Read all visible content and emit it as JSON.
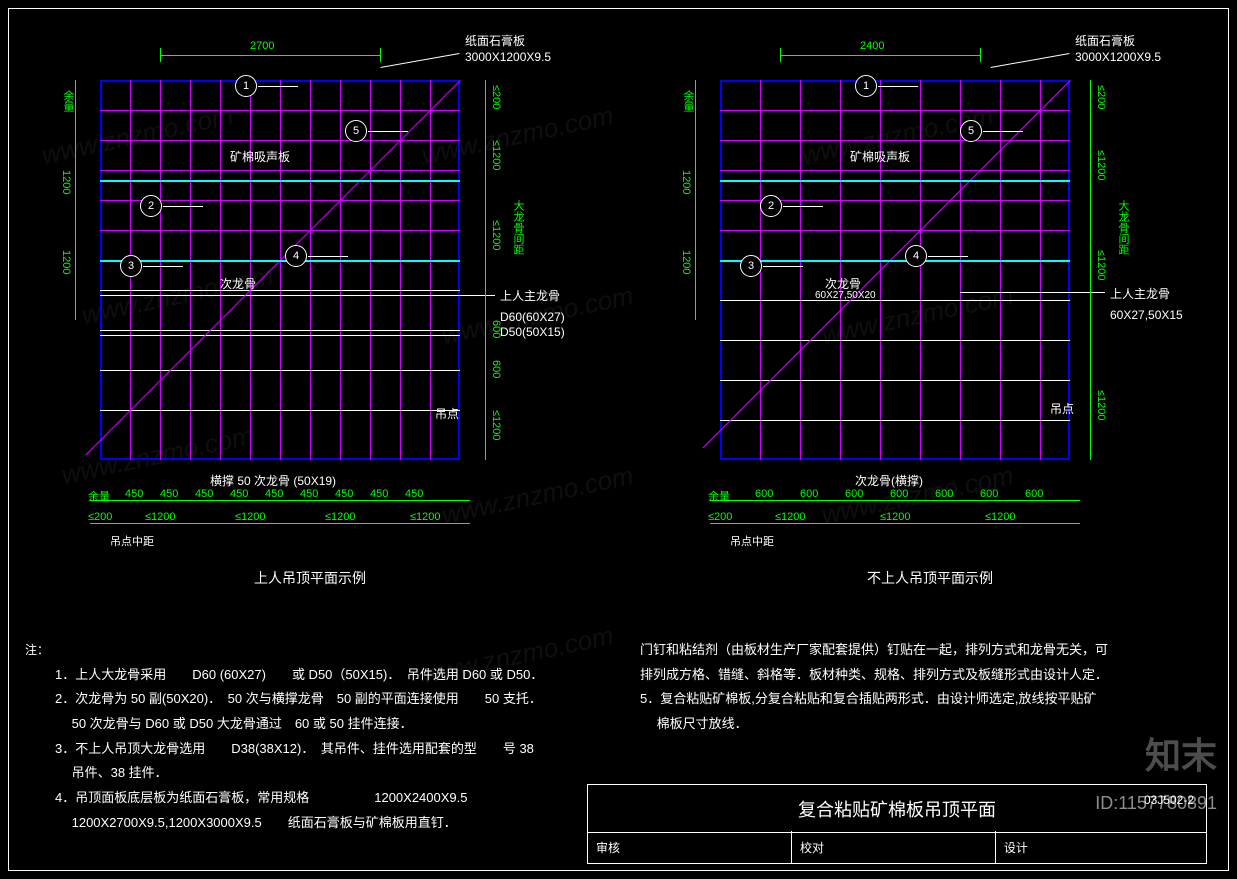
{
  "plans": {
    "left": {
      "top_dim": "2700",
      "top_label": "纸面石膏板",
      "top_spec": "3000X1200X9.5",
      "panel_label": "矿棉吸声板",
      "sub_keel": "次龙骨",
      "main_keel": "上人主龙骨",
      "keel_spec1": "D60(60X27)",
      "keel_spec2": "D50(50X15)",
      "hang_point": "吊点",
      "bottom_keel": "横撑 50 次龙骨  (50X19)",
      "bottom_dims": [
        "余量",
        "450",
        "450",
        "450",
        "450",
        "450",
        "450",
        "450",
        "450",
        "450"
      ],
      "bottom_groups": [
        "≤200",
        "≤1200",
        "≤1200",
        "≤1200",
        "≤1200"
      ],
      "bottom_label": "吊点中距",
      "title": "上人吊顶平面示例",
      "side_dims": [
        "余量",
        "1200",
        "1200"
      ],
      "right_dims": [
        "≤200",
        "≤1200",
        "≤1200",
        "600",
        "600",
        "≤1200"
      ],
      "right_label": "大龙骨间距",
      "sub_dim": "≤200"
    },
    "right": {
      "top_dim": "2400",
      "top_label": "纸面石膏板",
      "top_spec": "3000X1200X9.5",
      "panel_label": "矿棉吸声板",
      "sub_keel": "次龙骨",
      "sub_keel_spec": "60X27,50X20",
      "main_keel": "上人主龙骨",
      "keel_spec1": "60X27,50X15",
      "hang_point": "吊点",
      "bottom_keel": "次龙骨(横撑)",
      "bottom_dims": [
        "余量",
        "600",
        "600",
        "600",
        "600",
        "600",
        "600",
        "600"
      ],
      "bottom_groups": [
        "≤200",
        "≤1200",
        "≤1200",
        "≤1200"
      ],
      "bottom_label": "吊点中距",
      "title": "不上人吊顶平面示例",
      "side_dims": [
        "余量",
        "1200",
        "1200"
      ],
      "right_dims": [
        "≤200",
        "≤1200",
        "≤1200",
        "≤1200"
      ],
      "right_label": "大龙骨间距",
      "sub_dim": "≤200"
    }
  },
  "markers": [
    "1",
    "2",
    "3",
    "4",
    "5"
  ],
  "notes_left_head": "注：",
  "notes_left": [
    "1．上人大龙骨采用　　D60 (60X27)　　或 D50（50X15)．　吊件选用 D60 或 D50．",
    "2．次龙骨为 50 副(50X20)．　50 次与横撑龙骨　50 副的平面连接使用　　50 支托．",
    "　 50 次龙骨与 D60 或 D50 大龙骨通过　60 或 50 挂件连接．",
    "3．不上人吊顶大龙骨选用　　D38(38X12)．　其吊件、挂件选用配套的型　　号 38",
    "　 吊件、38 挂件．",
    "4．吊顶面板底层板为纸面石膏板，常用规格　　　　　1200X2400X9.5",
    "　 1200X2700X9.5,1200X3000X9.5　　纸面石膏板与矿棉板用直钉．"
  ],
  "notes_right": [
    "门钉和粘结剂（由板材生产厂家配套提供）钉贴在一起，排列方式和龙骨无关，可",
    "排列成方格、错缝、斜格等．板材种类、规格、排列方式及板缝形式由设计人定．",
    "5．复合粘贴矿棉板,分复合粘贴和复合插贴两形式．由设计师选定,放线按平贴矿",
    "　 棉板尺寸放线．"
  ],
  "title_block": {
    "main": "复合粘贴矿棉板吊顶平面",
    "drawing_no": "03J502-2",
    "fields": {
      "review": "审核",
      "check": "校对",
      "design": "设计"
    }
  },
  "brand": "知末",
  "id": "ID:1157780891",
  "watermark": "www.znzmo.com"
}
